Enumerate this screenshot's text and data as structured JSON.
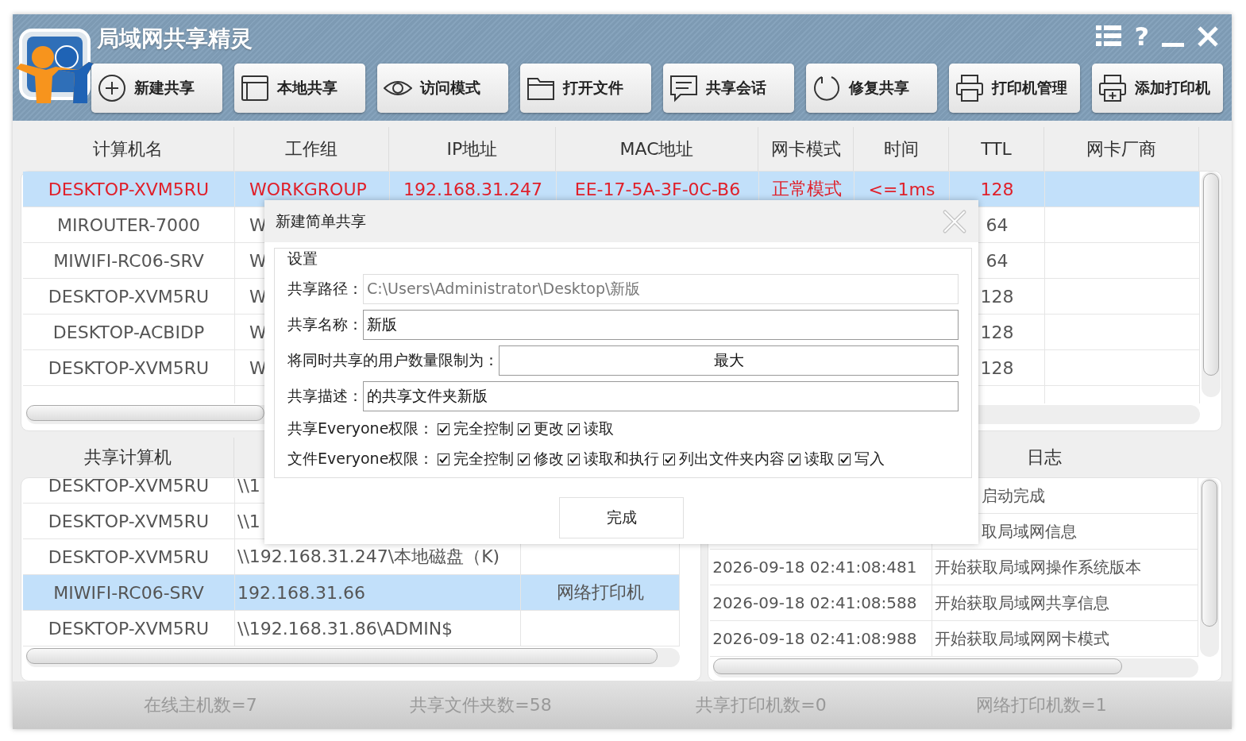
{
  "window": {
    "title": "局域网共享精灵",
    "help": "?"
  },
  "toolbar": [
    {
      "label": "新建共享"
    },
    {
      "label": "本地共享"
    },
    {
      "label": "访问模式"
    },
    {
      "label": "打开文件"
    },
    {
      "label": "共享会话"
    },
    {
      "label": "修复共享"
    },
    {
      "label": "打印机管理"
    },
    {
      "label": "添加打印机"
    }
  ],
  "hosts_table": {
    "columns": [
      "计算机名",
      "工作组",
      "IP地址",
      "MAC地址",
      "网卡模式",
      "时间",
      "TTL",
      "网卡厂商"
    ],
    "rows": [
      {
        "selected": true,
        "local": true,
        "cells": [
          "DESKTOP-XVM5RU",
          "WORKGROUP",
          "192.168.31.247",
          "EE-17-5A-3F-0C-B6",
          "正常模式",
          "<=1ms",
          "128",
          ""
        ]
      },
      {
        "selected": false,
        "local": false,
        "cells": [
          "MIROUTER-7000",
          "W",
          "",
          "",
          "",
          "",
          "64",
          ""
        ]
      },
      {
        "selected": false,
        "local": false,
        "cells": [
          "MIWIFI-RC06-SRV",
          "W",
          "",
          "",
          "",
          "",
          "64",
          ""
        ]
      },
      {
        "selected": false,
        "local": false,
        "cells": [
          "DESKTOP-XVM5RU",
          "W",
          "",
          "",
          "",
          "",
          "128",
          ""
        ]
      },
      {
        "selected": false,
        "local": false,
        "cells": [
          "DESKTOP-ACBIDP",
          "W",
          "",
          "",
          "",
          "",
          "128",
          ""
        ]
      },
      {
        "selected": false,
        "local": false,
        "cells": [
          "DESKTOP-XVM5RU",
          "W",
          "",
          "",
          "",
          "",
          "128",
          ""
        ]
      }
    ]
  },
  "shares_table": {
    "columns": [
      "共享计算机"
    ],
    "rows": [
      {
        "selected": false,
        "cells": [
          "DESKTOP-XVM5RU",
          "\\\\1",
          ""
        ]
      },
      {
        "selected": false,
        "cells": [
          "DESKTOP-XVM5RU",
          "\\\\1",
          ""
        ]
      },
      {
        "selected": false,
        "cells": [
          "DESKTOP-XVM5RU",
          "\\\\192.168.31.247\\本地磁盘（K)",
          ""
        ]
      },
      {
        "selected": true,
        "cells": [
          "MIWIFI-RC06-SRV",
          "192.168.31.66",
          "网络打印机"
        ]
      },
      {
        "selected": false,
        "cells": [
          "DESKTOP-XVM5RU",
          "\\\\192.168.31.86\\ADMIN$",
          ""
        ]
      }
    ]
  },
  "log": {
    "title": "日志",
    "rows": [
      {
        "kind": "clipped",
        "message": "启动完成"
      },
      {
        "kind": "clipped",
        "message": "取局域网信息"
      },
      {
        "kind": "full",
        "time": "2026-09-18 02:41:08:481",
        "message": "开始获取局域网操作系统版本"
      },
      {
        "kind": "full",
        "time": "2026-09-18 02:41:08:588",
        "message": "开始获取局域网共享信息"
      },
      {
        "kind": "full",
        "time": "2026-09-18 02:41:08:988",
        "message": "开始获取局域网网卡模式"
      }
    ]
  },
  "status_bar": [
    "在线主机数=7",
    "共享文件夹数=58",
    "共享打印机数=0",
    "网络打印机数=1"
  ],
  "dialog": {
    "title": "新建简单共享",
    "group": "设置",
    "fields": [
      {
        "label": "共享路径：",
        "value": "C:\\Users\\Administrator\\Desktop\\新版",
        "disabled": true,
        "kind": "text"
      },
      {
        "label": "共享名称：",
        "value": "新版",
        "disabled": false,
        "kind": "text"
      },
      {
        "label": "将同时共享的用户数量限制为：",
        "value": "最大",
        "disabled": false,
        "kind": "limit"
      },
      {
        "label": "共享描述：",
        "value": "的共享文件夹新版",
        "disabled": false,
        "kind": "text"
      }
    ],
    "permissions": [
      {
        "label": "共享Everyone权限：",
        "options": [
          {
            "label": "完全控制",
            "checked": true
          },
          {
            "label": "更改",
            "checked": true
          },
          {
            "label": "读取",
            "checked": true
          }
        ]
      },
      {
        "label": "文件Everyone权限：",
        "options": [
          {
            "label": "完全控制",
            "checked": true
          },
          {
            "label": "修改",
            "checked": true
          },
          {
            "label": "读取和执行",
            "checked": true
          },
          {
            "label": "列出文件夹内容",
            "checked": true
          },
          {
            "label": "读取",
            "checked": true
          },
          {
            "label": "写入",
            "checked": true
          }
        ]
      }
    ],
    "button": "完成"
  }
}
